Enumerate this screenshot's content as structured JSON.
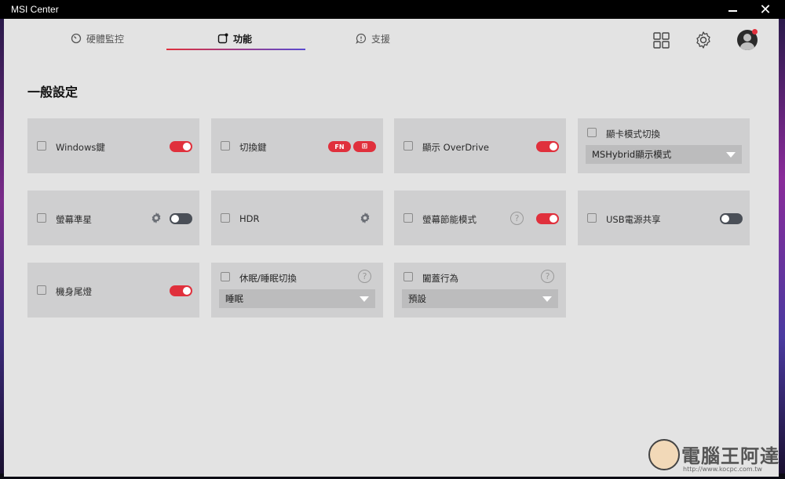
{
  "window": {
    "title": "MSI Center",
    "minimize_label": "—",
    "close_label": "✕"
  },
  "nav": {
    "tabs": [
      {
        "label": "硬體監控",
        "icon": "gauge-icon"
      },
      {
        "label": "功能",
        "icon": "feature-icon",
        "active": true
      },
      {
        "label": "支援",
        "icon": "support-icon"
      }
    ]
  },
  "page": {
    "title": "一般設定"
  },
  "cards": {
    "windows_key": {
      "label": "Windows鍵",
      "toggle": "on"
    },
    "switch_key": {
      "label": "切換鍵",
      "fn_label": "FN",
      "win_glyph": "⊞"
    },
    "overdrive": {
      "label": "顯示 OverDrive",
      "toggle": "on"
    },
    "gpu_mode": {
      "label": "顯卡模式切換",
      "selected": "MSHybrid顯示模式"
    },
    "crosshair": {
      "label": "螢幕準星",
      "toggle": "off"
    },
    "hdr": {
      "label": "HDR"
    },
    "screen_saving": {
      "label": "螢幕節能模式",
      "toggle": "on",
      "help": "?"
    },
    "usb_power": {
      "label": "USB電源共享",
      "toggle": "off"
    },
    "tail_light": {
      "label": "機身尾燈",
      "toggle": "on"
    },
    "sleep_switch": {
      "label": "休眠/睡眠切換",
      "selected": "睡眠",
      "help": "?"
    },
    "lid_action": {
      "label": "闔蓋行為",
      "selected": "預設",
      "help": "?"
    }
  },
  "watermark": {
    "text": "電腦王阿達",
    "url": "http://www.kocpc.com.tw"
  },
  "colors": {
    "accent_red": "#e0303c",
    "toggle_off": "#4a4f57",
    "card_bg": "#cfcfd0",
    "app_bg": "#e3e3e3"
  }
}
